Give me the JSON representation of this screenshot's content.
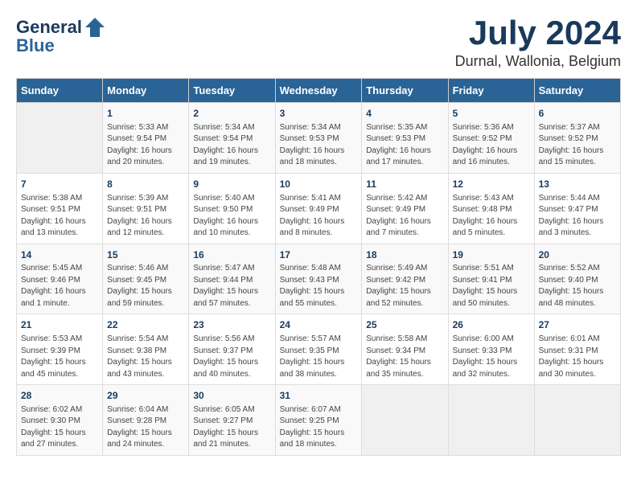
{
  "header": {
    "logo_line1": "General",
    "logo_line2": "Blue",
    "month": "July 2024",
    "location": "Durnal, Wallonia, Belgium"
  },
  "calendar": {
    "days_of_week": [
      "Sunday",
      "Monday",
      "Tuesday",
      "Wednesday",
      "Thursday",
      "Friday",
      "Saturday"
    ],
    "weeks": [
      [
        {
          "day": "",
          "content": ""
        },
        {
          "day": "1",
          "content": "Sunrise: 5:33 AM\nSunset: 9:54 PM\nDaylight: 16 hours\nand 20 minutes."
        },
        {
          "day": "2",
          "content": "Sunrise: 5:34 AM\nSunset: 9:54 PM\nDaylight: 16 hours\nand 19 minutes."
        },
        {
          "day": "3",
          "content": "Sunrise: 5:34 AM\nSunset: 9:53 PM\nDaylight: 16 hours\nand 18 minutes."
        },
        {
          "day": "4",
          "content": "Sunrise: 5:35 AM\nSunset: 9:53 PM\nDaylight: 16 hours\nand 17 minutes."
        },
        {
          "day": "5",
          "content": "Sunrise: 5:36 AM\nSunset: 9:52 PM\nDaylight: 16 hours\nand 16 minutes."
        },
        {
          "day": "6",
          "content": "Sunrise: 5:37 AM\nSunset: 9:52 PM\nDaylight: 16 hours\nand 15 minutes."
        }
      ],
      [
        {
          "day": "7",
          "content": "Sunrise: 5:38 AM\nSunset: 9:51 PM\nDaylight: 16 hours\nand 13 minutes."
        },
        {
          "day": "8",
          "content": "Sunrise: 5:39 AM\nSunset: 9:51 PM\nDaylight: 16 hours\nand 12 minutes."
        },
        {
          "day": "9",
          "content": "Sunrise: 5:40 AM\nSunset: 9:50 PM\nDaylight: 16 hours\nand 10 minutes."
        },
        {
          "day": "10",
          "content": "Sunrise: 5:41 AM\nSunset: 9:49 PM\nDaylight: 16 hours\nand 8 minutes."
        },
        {
          "day": "11",
          "content": "Sunrise: 5:42 AM\nSunset: 9:49 PM\nDaylight: 16 hours\nand 7 minutes."
        },
        {
          "day": "12",
          "content": "Sunrise: 5:43 AM\nSunset: 9:48 PM\nDaylight: 16 hours\nand 5 minutes."
        },
        {
          "day": "13",
          "content": "Sunrise: 5:44 AM\nSunset: 9:47 PM\nDaylight: 16 hours\nand 3 minutes."
        }
      ],
      [
        {
          "day": "14",
          "content": "Sunrise: 5:45 AM\nSunset: 9:46 PM\nDaylight: 16 hours\nand 1 minute."
        },
        {
          "day": "15",
          "content": "Sunrise: 5:46 AM\nSunset: 9:45 PM\nDaylight: 15 hours\nand 59 minutes."
        },
        {
          "day": "16",
          "content": "Sunrise: 5:47 AM\nSunset: 9:44 PM\nDaylight: 15 hours\nand 57 minutes."
        },
        {
          "day": "17",
          "content": "Sunrise: 5:48 AM\nSunset: 9:43 PM\nDaylight: 15 hours\nand 55 minutes."
        },
        {
          "day": "18",
          "content": "Sunrise: 5:49 AM\nSunset: 9:42 PM\nDaylight: 15 hours\nand 52 minutes."
        },
        {
          "day": "19",
          "content": "Sunrise: 5:51 AM\nSunset: 9:41 PM\nDaylight: 15 hours\nand 50 minutes."
        },
        {
          "day": "20",
          "content": "Sunrise: 5:52 AM\nSunset: 9:40 PM\nDaylight: 15 hours\nand 48 minutes."
        }
      ],
      [
        {
          "day": "21",
          "content": "Sunrise: 5:53 AM\nSunset: 9:39 PM\nDaylight: 15 hours\nand 45 minutes."
        },
        {
          "day": "22",
          "content": "Sunrise: 5:54 AM\nSunset: 9:38 PM\nDaylight: 15 hours\nand 43 minutes."
        },
        {
          "day": "23",
          "content": "Sunrise: 5:56 AM\nSunset: 9:37 PM\nDaylight: 15 hours\nand 40 minutes."
        },
        {
          "day": "24",
          "content": "Sunrise: 5:57 AM\nSunset: 9:35 PM\nDaylight: 15 hours\nand 38 minutes."
        },
        {
          "day": "25",
          "content": "Sunrise: 5:58 AM\nSunset: 9:34 PM\nDaylight: 15 hours\nand 35 minutes."
        },
        {
          "day": "26",
          "content": "Sunrise: 6:00 AM\nSunset: 9:33 PM\nDaylight: 15 hours\nand 32 minutes."
        },
        {
          "day": "27",
          "content": "Sunrise: 6:01 AM\nSunset: 9:31 PM\nDaylight: 15 hours\nand 30 minutes."
        }
      ],
      [
        {
          "day": "28",
          "content": "Sunrise: 6:02 AM\nSunset: 9:30 PM\nDaylight: 15 hours\nand 27 minutes."
        },
        {
          "day": "29",
          "content": "Sunrise: 6:04 AM\nSunset: 9:28 PM\nDaylight: 15 hours\nand 24 minutes."
        },
        {
          "day": "30",
          "content": "Sunrise: 6:05 AM\nSunset: 9:27 PM\nDaylight: 15 hours\nand 21 minutes."
        },
        {
          "day": "31",
          "content": "Sunrise: 6:07 AM\nSunset: 9:25 PM\nDaylight: 15 hours\nand 18 minutes."
        },
        {
          "day": "",
          "content": ""
        },
        {
          "day": "",
          "content": ""
        },
        {
          "day": "",
          "content": ""
        }
      ]
    ]
  }
}
